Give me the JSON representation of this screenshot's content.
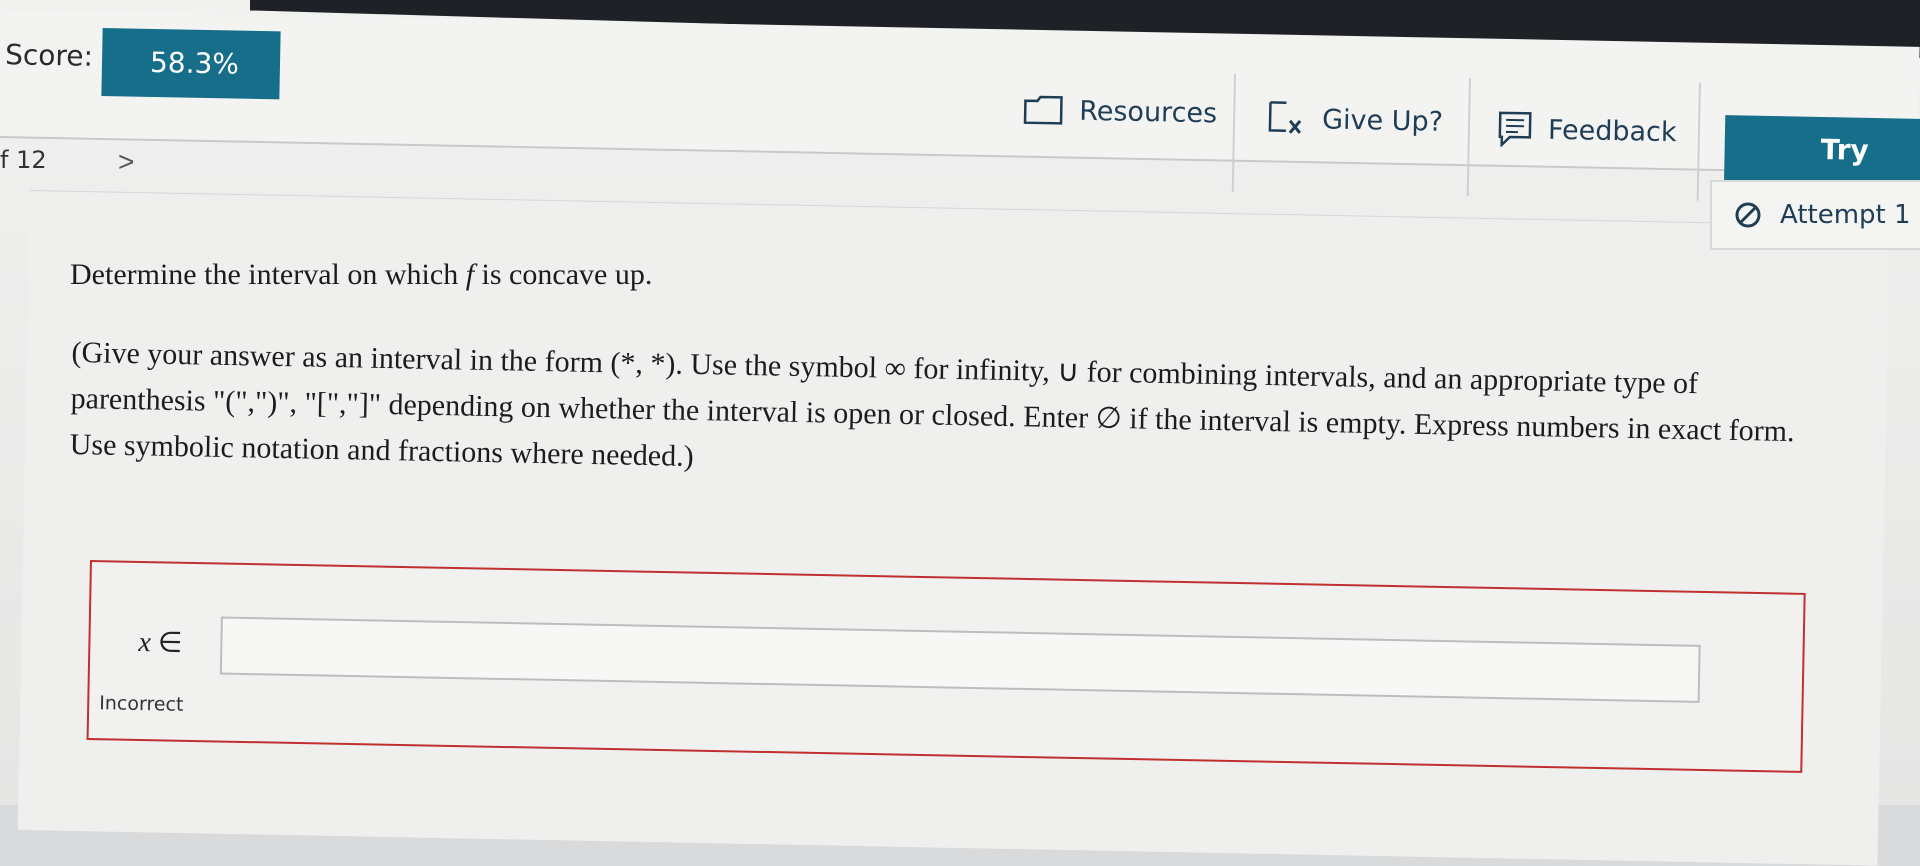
{
  "header": {
    "score_label": "Score:",
    "score_value": "58.3%",
    "resources_label": "Resources",
    "give_up_label": "Give Up?",
    "feedback_label": "Feedback",
    "try_again_label": "Try Agai"
  },
  "nav": {
    "question_counter": "f 12",
    "next_arrow": ">"
  },
  "attempt": {
    "label": "Attempt 1"
  },
  "question": {
    "prompt_start": "Determine the interval on which ",
    "prompt_var": "f",
    "prompt_end": " is concave up.",
    "instructions": "(Give your answer as an interval in the form (*, *). Use the symbol ∞ for infinity, ∪ for combining intervals, and an appropriate type of parenthesis \"(\",\")\", \"[\",\"]\" depending on whether the interval is open or closed. Enter ∅ if the interval is empty. Express numbers in exact form. Use symbolic notation and fractions where needed.)"
  },
  "answer": {
    "variable": "x",
    "membership": " ∈",
    "input_value": "",
    "status": "Incorrect"
  },
  "colors": {
    "brand_teal": "#176e8a",
    "error_red": "#c03030",
    "text_navy": "#1f3d55"
  }
}
